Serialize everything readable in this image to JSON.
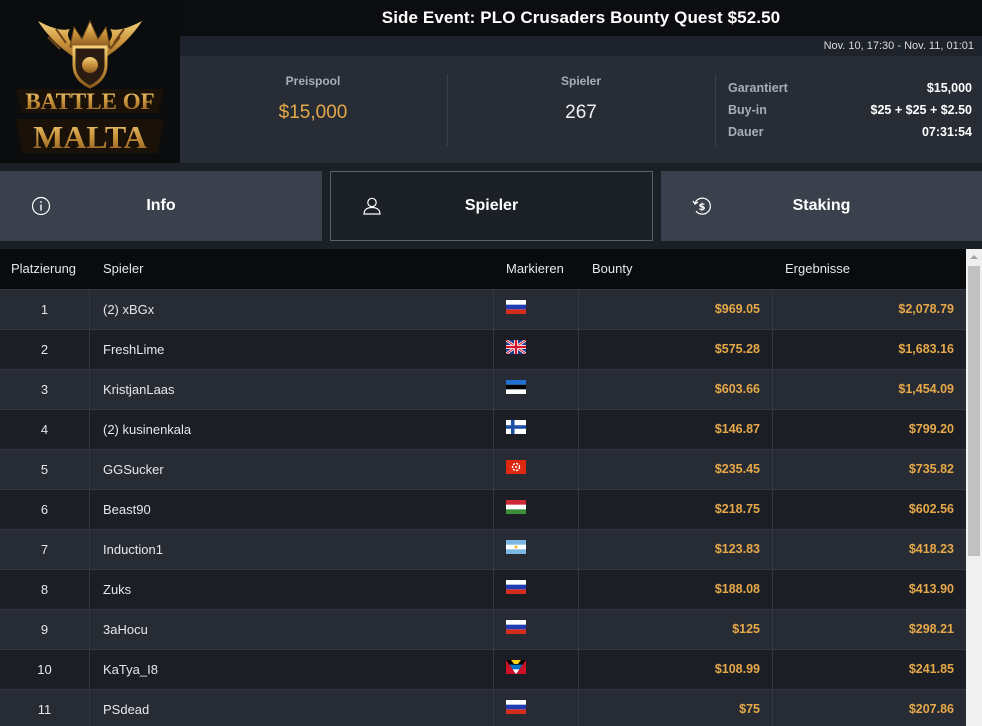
{
  "header": {
    "title": "Side Event: PLO Crusaders Bounty Quest $52.50",
    "date_range": "Nov. 10, 17:30 - Nov. 11, 01:01",
    "logo": {
      "line1": "BATTLE OF",
      "line2": "MALTA"
    }
  },
  "stats": {
    "prizepool_label": "Preispool",
    "prizepool_value": "$15,000",
    "players_label": "Spieler",
    "players_value": "267",
    "details": [
      {
        "key": "Garantiert",
        "value": "$15,000"
      },
      {
        "key": "Buy-in",
        "value": "$25 + $25 + $2.50"
      },
      {
        "key": "Dauer",
        "value": "07:31:54"
      }
    ]
  },
  "tabs": [
    {
      "label": "Info",
      "icon": "info-icon"
    },
    {
      "label": "Spieler",
      "icon": "user-icon"
    },
    {
      "label": "Staking",
      "icon": "dollar-icon"
    }
  ],
  "active_tab": "Spieler",
  "table": {
    "headers": [
      "Platzierung",
      "Spieler",
      "Markieren",
      "Bounty",
      "Ergebnisse"
    ],
    "rows": [
      {
        "rank": "1",
        "name": "(2) xBGx",
        "flag": "russia",
        "bounty": "$969.05",
        "result": "$2,078.79"
      },
      {
        "rank": "2",
        "name": "FreshLime",
        "flag": "united-kingdom",
        "bounty": "$575.28",
        "result": "$1,683.16"
      },
      {
        "rank": "3",
        "name": "KristjanLaas",
        "flag": "estonia",
        "bounty": "$603.66",
        "result": "$1,454.09"
      },
      {
        "rank": "4",
        "name": "(2) kusinenkala",
        "flag": "finland",
        "bounty": "$146.87",
        "result": "$799.20"
      },
      {
        "rank": "5",
        "name": "GGSucker",
        "flag": "hong-kong",
        "bounty": "$235.45",
        "result": "$735.82"
      },
      {
        "rank": "6",
        "name": "Beast90",
        "flag": "hungary",
        "bounty": "$218.75",
        "result": "$602.56"
      },
      {
        "rank": "7",
        "name": "Induction1",
        "flag": "argentina",
        "bounty": "$123.83",
        "result": "$418.23"
      },
      {
        "rank": "8",
        "name": "Zuks",
        "flag": "russia",
        "bounty": "$188.08",
        "result": "$413.90"
      },
      {
        "rank": "9",
        "name": "3aHocu",
        "flag": "russia",
        "bounty": "$125",
        "result": "$298.21"
      },
      {
        "rank": "10",
        "name": "KaTya_I8",
        "flag": "antigua-and-barbuda",
        "bounty": "$108.99",
        "result": "$241.85"
      },
      {
        "rank": "11",
        "name": "PSdead",
        "flag": "russia",
        "bounty": "$75",
        "result": "$207.86"
      }
    ]
  },
  "colors": {
    "gold": "#e6a94a",
    "tab_bg": "#3a414c",
    "row_odd": "#272b33",
    "row_even": "#1b1e25"
  }
}
